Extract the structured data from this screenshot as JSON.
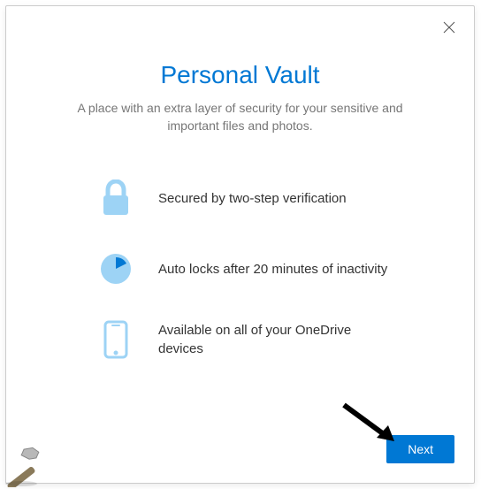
{
  "dialog": {
    "title": "Personal Vault",
    "subtitle": "A place with an extra layer of security for your sensitive and important files and photos.",
    "features": [
      {
        "text": "Secured by two-step verification"
      },
      {
        "text": "Auto locks after 20 minutes of inactivity"
      },
      {
        "text": "Available on all of your OneDrive devices"
      }
    ],
    "nextLabel": "Next"
  }
}
